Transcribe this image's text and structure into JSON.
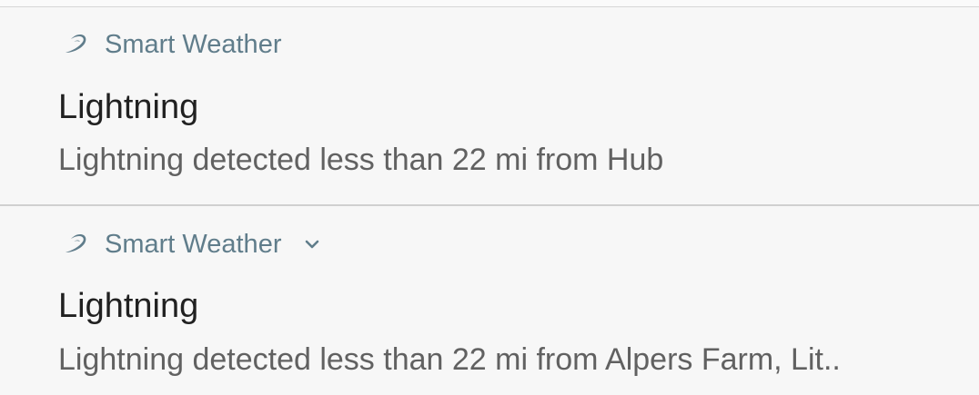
{
  "notifications": [
    {
      "app_name": "Smart Weather",
      "app_icon": "smart-weather-swirl-icon",
      "title": "Lightning",
      "body": "Lightning detected less than 22 mi from Hub",
      "expandable": false
    },
    {
      "app_name": "Smart Weather",
      "app_icon": "smart-weather-swirl-icon",
      "expand_icon": "chevron-down-icon",
      "title": "Lightning",
      "body": "Lightning detected less than 22 mi from Alpers Farm, Lit..",
      "expandable": true
    }
  ],
  "colors": {
    "app_name": "#607d8b",
    "title": "#212121",
    "body": "#616161",
    "background": "#f7f7f7",
    "divider": "#d0d0d0"
  }
}
